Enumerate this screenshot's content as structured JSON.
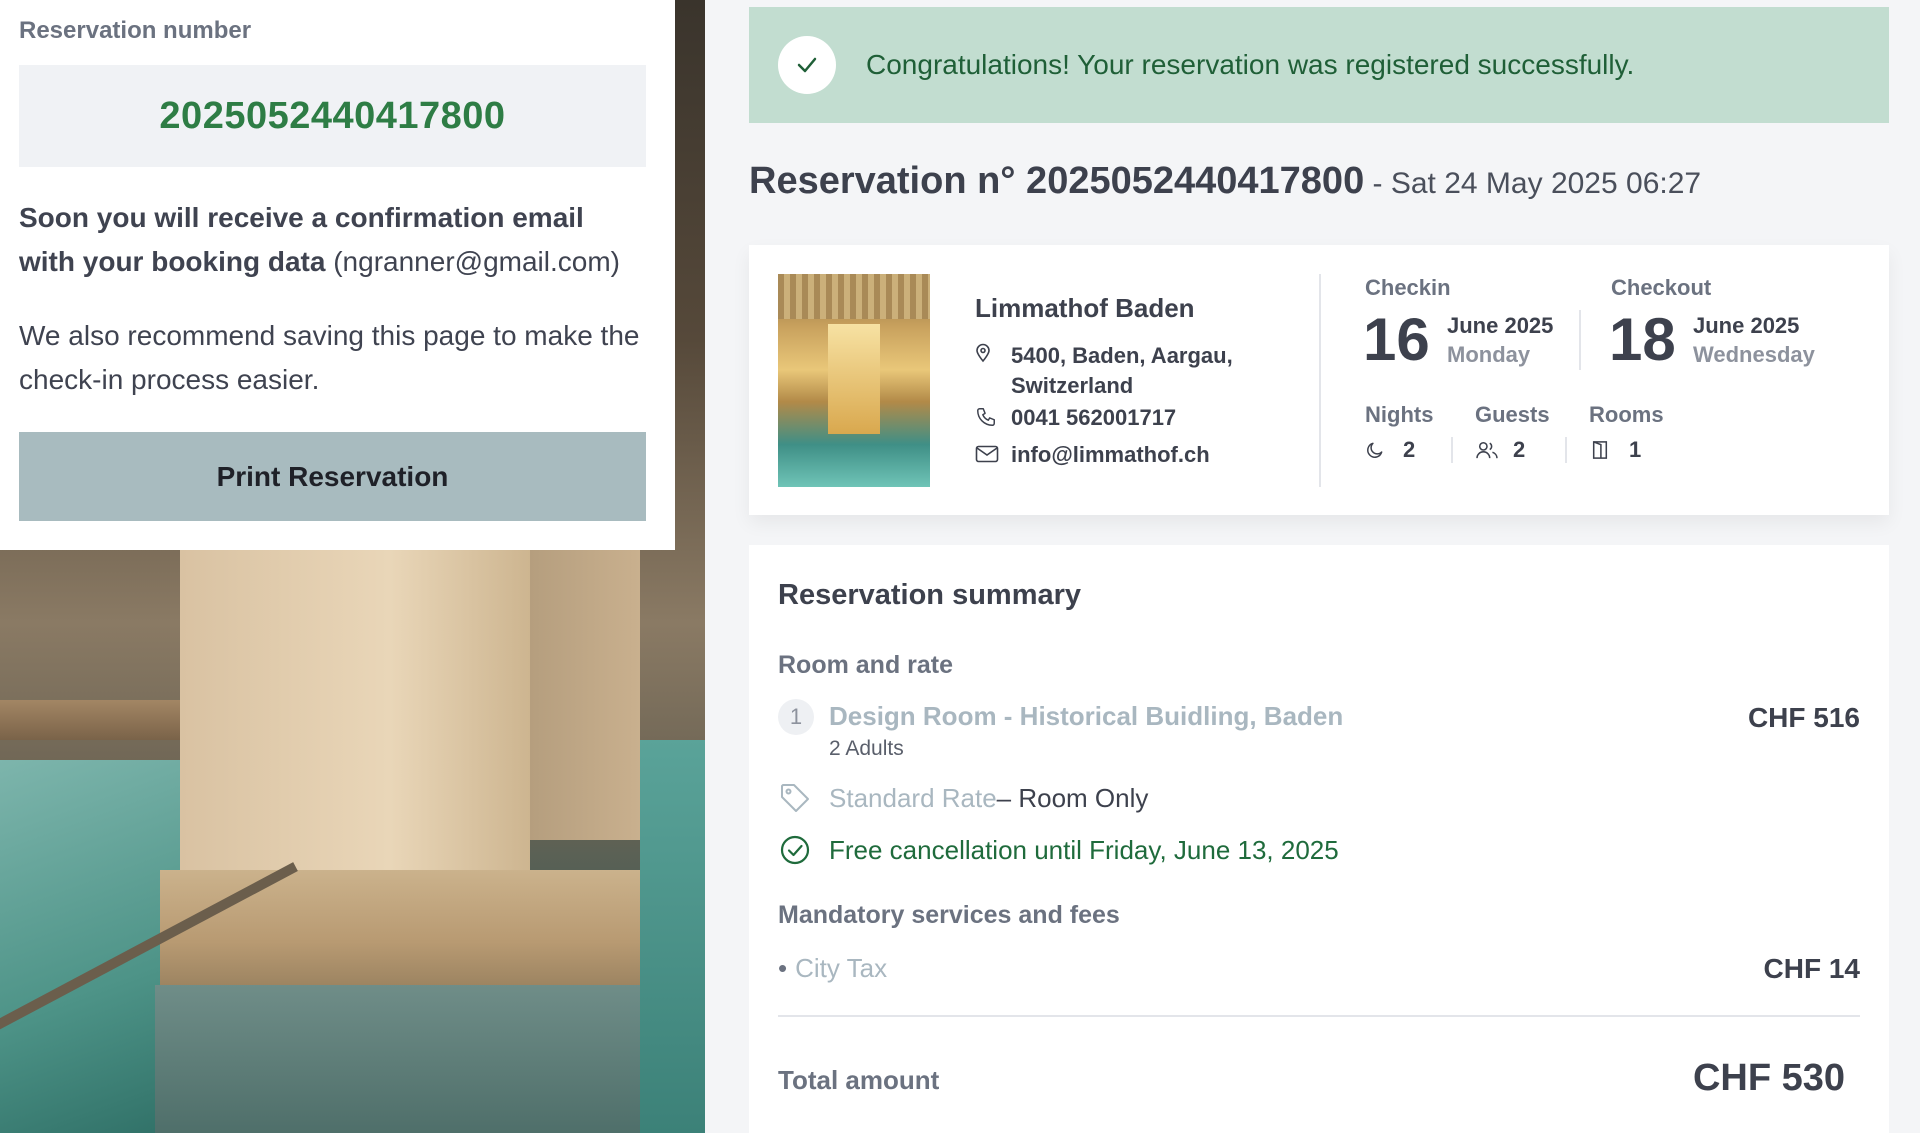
{
  "left_card": {
    "reservation_number_label": "Reservation number",
    "reservation_number": "2025052440417800",
    "confirmation_text_bold": "Soon you will receive a confirmation email with your booking data",
    "confirmation_email": "(ngranner@gmail.com)",
    "recommend_text": "We also recommend saving this page to make the check-in process easier.",
    "print_button": "Print Reservation"
  },
  "banner": {
    "message": "Congratulations! Your reservation was registered successfully.",
    "icon": "check-icon"
  },
  "header": {
    "title": "Reservation n° 2025052440417800",
    "datetime": " - Sat 24 May 2025 06:27"
  },
  "hotel": {
    "name": "Limmathof Baden",
    "address_line1": "5400, Baden, Aargau,",
    "address_line2": "Switzerland",
    "phone": "0041 562001717",
    "email": "info@limmathof.ch"
  },
  "stay": {
    "checkin_label": "Checkin",
    "checkin_day": "16",
    "checkin_month": "June 2025",
    "checkin_weekday": "Monday",
    "checkout_label": "Checkout",
    "checkout_day": "18",
    "checkout_month": "June 2025",
    "checkout_weekday": "Wednesday",
    "nights_label": "Nights",
    "nights": "2",
    "guests_label": "Guests",
    "guests": "2",
    "rooms_label": "Rooms",
    "rooms": "1"
  },
  "summary": {
    "title": "Reservation summary",
    "room_rate_title": "Room and rate",
    "room_index": "1",
    "room_name": "Design Room - Historical Buidling, Baden",
    "room_occupancy": "2 Adults",
    "room_price": "CHF 516",
    "rate_name": "Standard Rate",
    "rate_board": " – Room Only",
    "cancellation": "Free cancellation until Friday, June 13, 2025",
    "fees_title": "Mandatory services and fees",
    "fee_bullet": "•",
    "fee_name": "City Tax",
    "fee_price": "CHF 14",
    "total_label": "Total amount",
    "total_value": "CHF 530"
  },
  "colors": {
    "success_green": "#1f5f37",
    "banner_bg": "#c2ddd0",
    "reservation_number_green": "#2e7d45",
    "print_button_bg": "#a8bbbf"
  }
}
